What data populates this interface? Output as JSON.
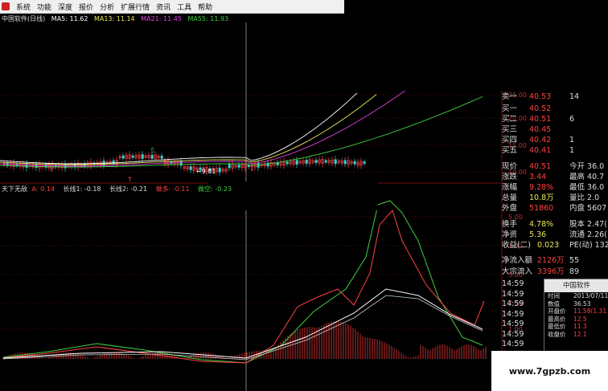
{
  "menu": {
    "items": [
      "系统",
      "功能",
      "深度",
      "报价",
      "分析",
      "扩展行情",
      "资讯",
      "工具",
      "帮助"
    ]
  },
  "kline": {
    "title": "中国软件(日线)",
    "ma": [
      {
        "label": "MA5: 11.62",
        "color": "#ffffff"
      },
      {
        "label": "MA13: 11.14",
        "color": "#e8e85a"
      },
      {
        "label": "MA21: 11.45",
        "color": "#e040e0"
      },
      {
        "label": "MA55: 11.93",
        "color": "#40d040"
      }
    ],
    "low_label": "9.81",
    "price_ticks": [
      "25.00",
      "20.00",
      "15.00",
      "10.00"
    ]
  },
  "indicator": {
    "name": "天下无敌",
    "values": [
      {
        "label": "A: 0.14",
        "color": "#ff4040"
      },
      {
        "label": "长线1: -0.18",
        "color": "#dddddd"
      },
      {
        "label": "长线2: -0.21",
        "color": "#dddddd"
      },
      {
        "label": "做多: -0.11",
        "color": "#ff4040"
      },
      {
        "label": "做空: -0.23",
        "color": "#40d040"
      }
    ],
    "ticks": [
      "5.00",
      "4.00",
      "3.00",
      "2.00",
      "1.00"
    ]
  },
  "quote": {
    "rows": [
      {
        "l": "卖一",
        "v": "40.53",
        "r": "14",
        "vc": "#ff4040"
      },
      {
        "l": "买一",
        "v": "40.52",
        "r": "",
        "vc": "#ff4040"
      },
      {
        "l": "买二",
        "v": "40.51",
        "r": "6",
        "vc": "#ff4040"
      },
      {
        "l": "买三",
        "v": "40.45",
        "r": "",
        "vc": "#ff4040"
      },
      {
        "l": "买四",
        "v": "40.42",
        "r": "1",
        "vc": "#ff4040"
      },
      {
        "l": "买五",
        "v": "40.41",
        "r": "1",
        "vc": "#ff4040"
      },
      {
        "l": "现价",
        "v": "40.51",
        "r": "今开 36.0",
        "vc": "#ff4040"
      },
      {
        "l": "涨跌",
        "v": "3.44",
        "r": "最高 40.7",
        "vc": "#ff4040"
      },
      {
        "l": "涨幅",
        "v": "9.28%",
        "r": "最低 36.0",
        "vc": "#ff4040"
      },
      {
        "l": "总量",
        "v": "10.8万",
        "r": "量比 2.0",
        "vc": "#e8e85a"
      },
      {
        "l": "外盘",
        "v": "51860",
        "r": "内盘 5607",
        "vc": "#ff4040"
      },
      {
        "l": "换手",
        "v": "4.78%",
        "r": "股本 2.47(",
        "vc": "#e8e85a"
      },
      {
        "l": "净资",
        "v": "5.36",
        "r": "流通 2.26(",
        "vc": "#e8e85a"
      },
      {
        "l": "收益(二)",
        "v": "0.023",
        "r": "PE(动) 1323.",
        "vc": "#e8e85a"
      },
      {
        "l": "净流入额",
        "v": "2126万",
        "r": "55",
        "vc": "#ff4040"
      },
      {
        "l": "大宗流入",
        "v": "3396万",
        "r": "89",
        "vc": "#ff4040"
      }
    ],
    "ticks": [
      "14:59",
      "14:59",
      "14:59",
      "14:59",
      "14:59",
      "14:59",
      "14:59",
      "14:59"
    ]
  },
  "popup": {
    "title": "中国软件",
    "rows": [
      {
        "l": "时间",
        "v": "2013/07/11/"
      },
      {
        "l": "数值",
        "v": "36.53"
      },
      {
        "l": "开盘价",
        "v": "11.58(1.31"
      },
      {
        "l": "最高价",
        "v": "12.5"
      },
      {
        "l": "最低价",
        "v": "11.3"
      },
      {
        "l": "收盘价",
        "v": "12.1"
      }
    ]
  },
  "watermark": "www.7gpzb.com"
}
